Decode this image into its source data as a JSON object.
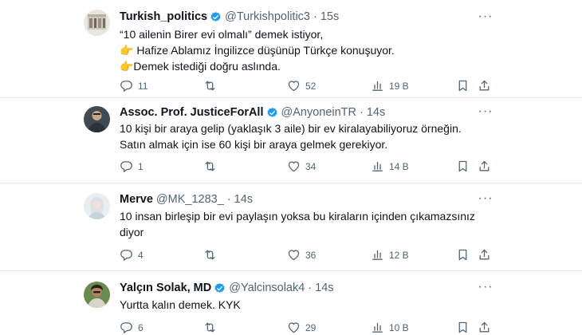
{
  "tweets": [
    {
      "name": "Turkish_politics",
      "handle": "@Turkishpolitic3",
      "time": "15s",
      "lines": [
        "“10 ailenin Birer evi olmalı” demek istiyor,",
        "👉 Hafize Ablamız İngilizce düşünüp Türkçe konuşuyor.",
        "👉Demek istediği doğru aslında."
      ],
      "replies": "11",
      "retweets": "",
      "likes": "52",
      "views": "19 B",
      "verified": true
    },
    {
      "name": "Assoc. Prof. JusticeForAll",
      "handle": "@AnyoneinTR",
      "time": "14s",
      "lines": [
        "10 kişi bir araya gelip (yaklaşık 3 aile) bir ev kiralayabiliyoruz örneğin.",
        "Satın almak için ise 60 kişi bir araya gelmek gerekiyor."
      ],
      "replies": "1",
      "retweets": "",
      "likes": "34",
      "views": "14 B",
      "verified": true
    },
    {
      "name": "Merve",
      "handle": "@MK_1283_",
      "time": "14s",
      "lines": [
        "10 insan birleşip bir evi paylaşın yoksa bu kiraların içinden çıkamazsınız",
        "diyor"
      ],
      "replies": "4",
      "retweets": "",
      "likes": "36",
      "views": "12 B",
      "verified": false
    },
    {
      "name": "Yalçın Solak, MD",
      "handle": "@Yalcinsolak4",
      "time": "14s",
      "lines": [
        "Yurtta kalın demek. KYK"
      ],
      "replies": "6",
      "retweets": "",
      "likes": "29",
      "views": "10 B",
      "verified": true
    }
  ],
  "ui": {
    "dot": "·",
    "more": "···"
  },
  "colors": {
    "verified": "#1d9bf0",
    "secondary_text": "#536471",
    "divider": "#e6ecf0"
  }
}
